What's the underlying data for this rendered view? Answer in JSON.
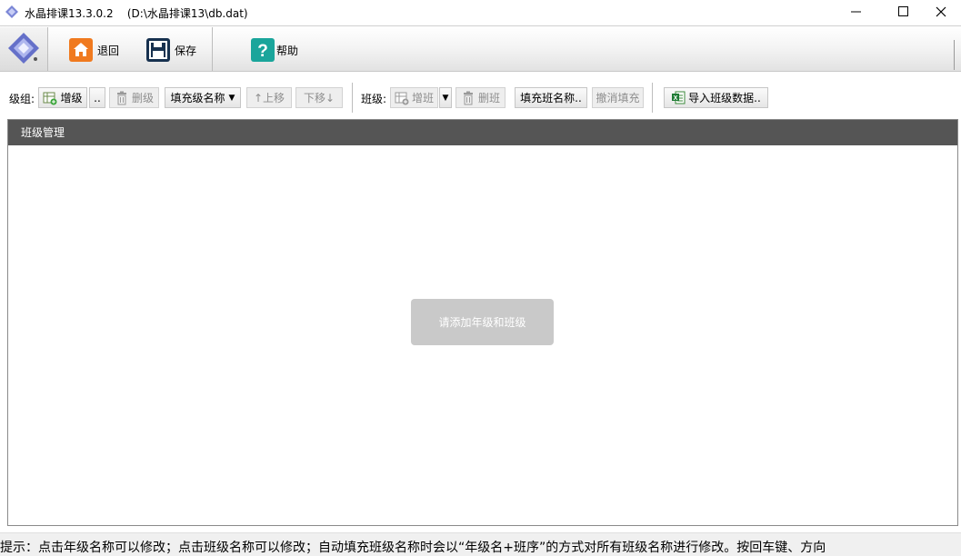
{
  "window": {
    "title": "水晶排课13.3.0.2    (D:\\水晶排课13\\db.dat)",
    "controls": {
      "minimize": "minimize-icon",
      "maximize": "maximize-icon",
      "close": "close-icon"
    }
  },
  "toolbar": {
    "back_label": "退回",
    "save_label": "保存",
    "help_label": "帮助",
    "icons": {
      "logo": "crystal-logo-icon",
      "back": "home-icon",
      "save": "floppy-disk-icon",
      "help": "question-mark-icon"
    },
    "colors": {
      "back_icon": "#f07a1f",
      "save_icon": "#17314f",
      "help_icon": "#1aa59b"
    }
  },
  "grade_bar": {
    "label": "级组:",
    "add": "增级",
    "more": "..",
    "delete": "删级",
    "fill_names": "填充级名称",
    "move_up": "↑上移",
    "move_down": "下移↓"
  },
  "class_bar": {
    "label": "班级:",
    "add": "增班",
    "delete": "删班",
    "fill_names": "填充班名称..",
    "cancel_fill": "撤消填充",
    "import": "导入班级数据.."
  },
  "panel": {
    "title": "班级管理",
    "empty_message": "请添加年级和班级"
  },
  "status": {
    "hint": "提示：点击年级名称可以修改；点击班级名称可以修改；自动填充班级名称时会以“年级名+班序”的方式对所有班级名称进行修改。按回车键、方向"
  }
}
